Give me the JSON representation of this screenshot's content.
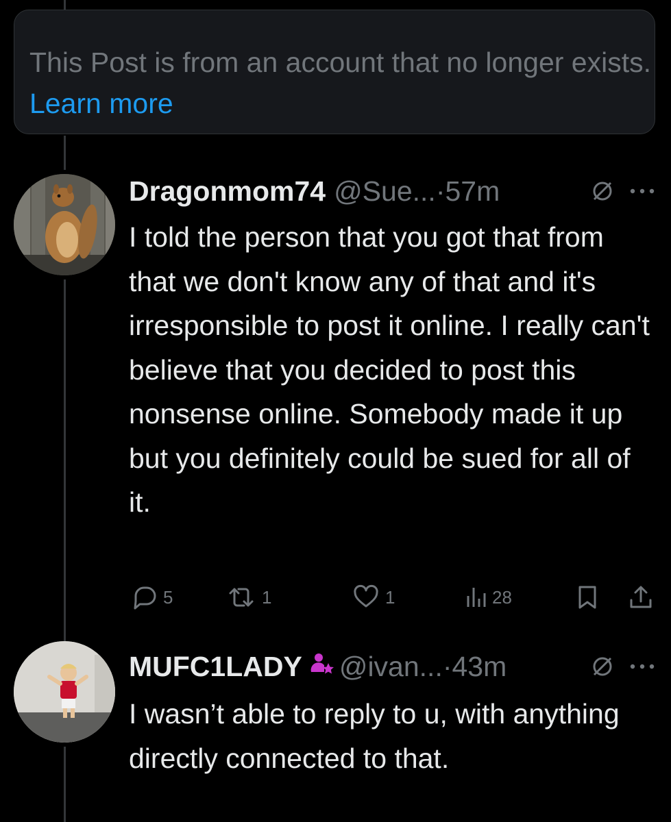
{
  "notice": {
    "text": "This Post is from an account that no longer exists.",
    "link": "Learn more"
  },
  "posts": [
    {
      "display_name": "Dragonmom74",
      "handle": "@Sue...",
      "separator": "·",
      "time": "57m",
      "avatar_icon": "squirrel-avatar",
      "text": "I told the person that you got that from that we don't know any of that and it's irresponsible to post it online. I really can't believe that you decided to post this nonsense online. Somebody made it up but you definitely could be sued for all of it.",
      "actions": {
        "replies": "5",
        "reposts": "1",
        "likes": "1",
        "views": "28"
      }
    },
    {
      "display_name": "MUFC1LADY",
      "handle": "@ivan...",
      "separator": "·",
      "time": "43m",
      "avatar_icon": "child-photo-avatar",
      "badge_icon": "person-star-icon",
      "text": "I wasn’t able to reply to u, with anything directly connected to that."
    }
  ],
  "colors": {
    "background": "#000000",
    "text_primary": "#e7e9ea",
    "text_secondary": "#71767b",
    "link": "#1d9bf0",
    "badge": "#c936cc",
    "notice_bg": "#16181c"
  }
}
